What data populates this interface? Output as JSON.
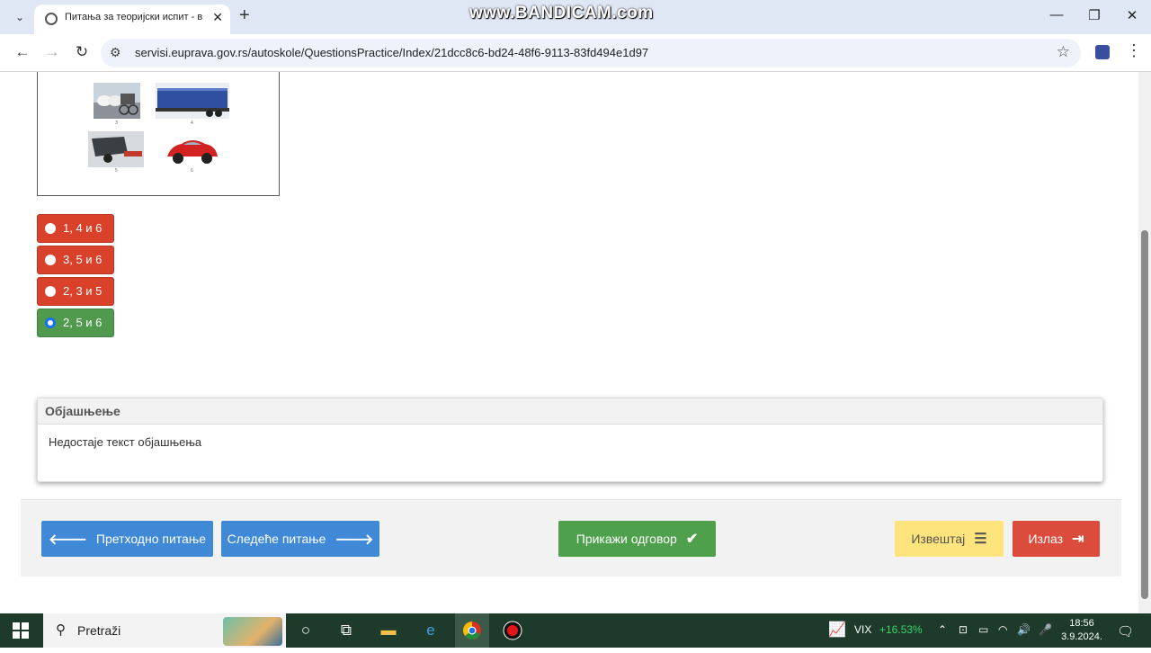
{
  "browser": {
    "tab_title": "Питања за теоријски испит - в",
    "watermark": "www.BANDICAM.com",
    "url": "servisi.euprava.gov.rs/autoskole/QuestionsPractice/Index/21dcc8c6-bd24-48f6-9113-83fd494e1d97"
  },
  "question_images": {
    "labels": [
      "3",
      "4",
      "5",
      "6"
    ]
  },
  "answers": [
    {
      "label": "1, 4 и 6",
      "state": "wrong"
    },
    {
      "label": "3, 5 и 6",
      "state": "wrong"
    },
    {
      "label": "2, 3 и 5",
      "state": "wrong"
    },
    {
      "label": "2, 5 и 6",
      "state": "correct-selected"
    }
  ],
  "explanation": {
    "title": "Објашњење",
    "text": "Недостаје текст објашњења"
  },
  "footer": {
    "prev_label": "Претходно питање",
    "next_label": "Следеће питање",
    "show_answer_label": "Прикажи одговор",
    "report_label": "Извештај",
    "exit_label": "Излаз"
  },
  "colors": {
    "wrong": "#d9412b",
    "correct": "#4f9a4d",
    "primary": "#3f89d6",
    "success": "#4ea04c",
    "warning": "#fde47c",
    "danger": "#dc4c3d"
  },
  "taskbar": {
    "search_placeholder": "Pretraži",
    "vix_label": "VIX",
    "vix_change": "+16.53%",
    "time": "18:56",
    "date": "3.9.2024."
  }
}
